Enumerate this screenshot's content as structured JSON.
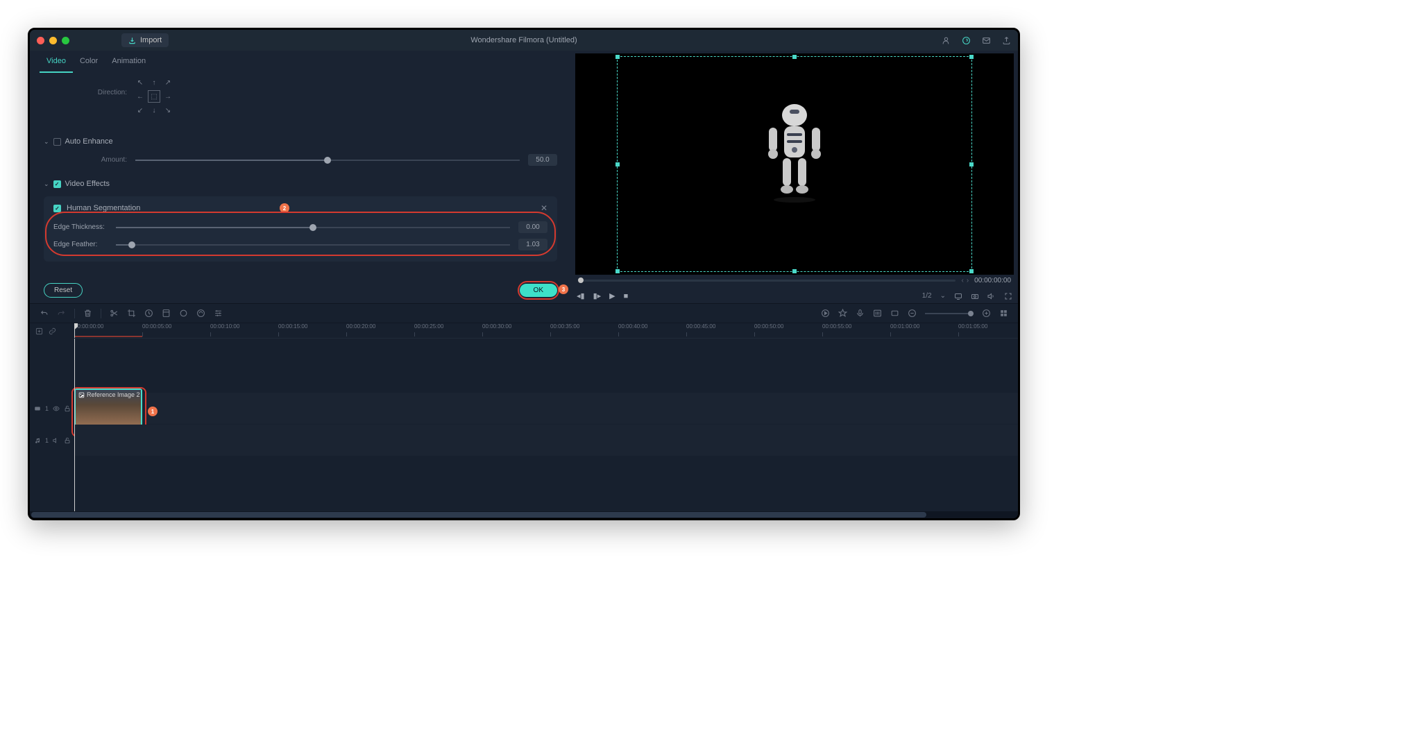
{
  "titlebar": {
    "title": "Wondershare Filmora (Untitled)",
    "import_label": "Import"
  },
  "tabs": {
    "video": "Video",
    "color": "Color",
    "animation": "Animation"
  },
  "direction": {
    "label": "Direction:"
  },
  "auto_enhance": {
    "title": "Auto Enhance",
    "amount_label": "Amount:",
    "amount_value": "50.0"
  },
  "video_effects": {
    "title": "Video Effects",
    "human_seg": "Human Segmentation",
    "edge_thickness_label": "Edge Thickness:",
    "edge_thickness_value": "0.00",
    "edge_feather_label": "Edge Feather:",
    "edge_feather_value": "1.03"
  },
  "footer": {
    "reset": "Reset",
    "ok": "OK"
  },
  "preview": {
    "timecode": "00:00:00:00",
    "scale": "1/2"
  },
  "timeline": {
    "clip_label": "Reference Image 2",
    "track_video": "1",
    "track_audio": "1",
    "ticks": [
      "00:00:00:00",
      "00:00:05:00",
      "00:00:10:00",
      "00:00:15:00",
      "00:00:20:00",
      "00:00:25:00",
      "00:00:30:00",
      "00:00:35:00",
      "00:00:40:00",
      "00:00:45:00",
      "00:00:50:00",
      "00:00:55:00",
      "00:01:00:00",
      "00:01:05:00"
    ]
  },
  "badges": {
    "b1": "1",
    "b2": "2",
    "b3": "3"
  }
}
